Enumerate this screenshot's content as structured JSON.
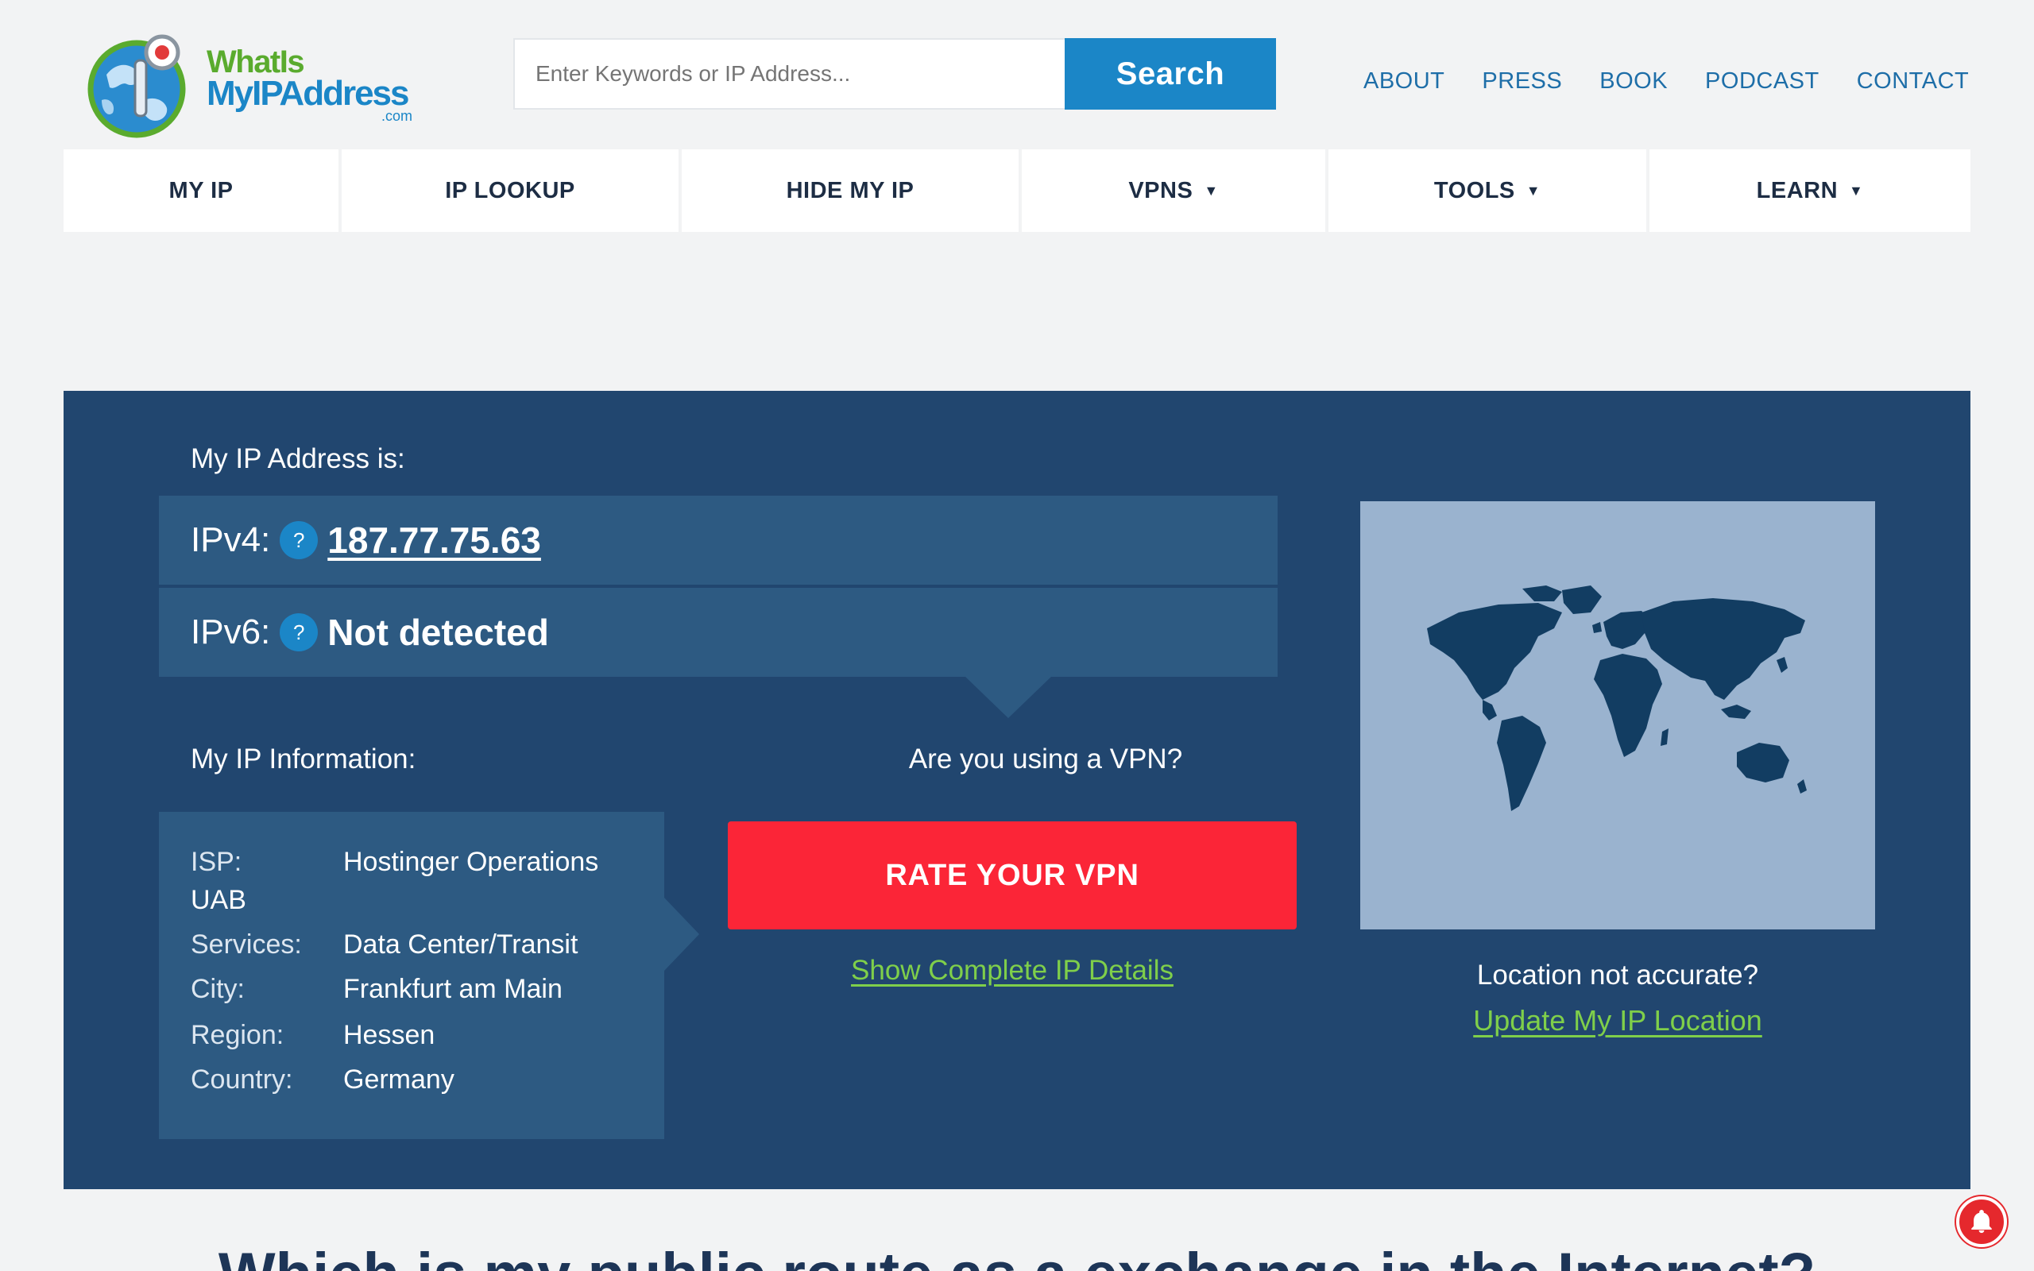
{
  "logo": {
    "line1": "WhatIs",
    "line2": "MyIPAddress",
    "line3": ".com"
  },
  "search": {
    "placeholder": "Enter Keywords or IP Address...",
    "button_label": "Search"
  },
  "top_links": [
    "ABOUT",
    "PRESS",
    "BOOK",
    "PODCAST",
    "CONTACT"
  ],
  "nav": {
    "items": [
      {
        "label": "MY IP",
        "dropdown": false
      },
      {
        "label": "IP LOOKUP",
        "dropdown": false
      },
      {
        "label": "HIDE MY IP",
        "dropdown": false
      },
      {
        "label": "VPNS",
        "dropdown": true
      },
      {
        "label": "TOOLS",
        "dropdown": true
      },
      {
        "label": "LEARN",
        "dropdown": true
      }
    ],
    "caret": "▼"
  },
  "ip": {
    "heading": "My IP Address is:",
    "ipv4_label": "IPv4:",
    "ipv4_value": "187.77.75.63",
    "ipv6_label": "IPv6:",
    "ipv6_value": "Not detected",
    "help_glyph": "?"
  },
  "info": {
    "heading": "My IP Information:",
    "isp_label": "ISP:",
    "isp_value": "Hostinger Operations",
    "isp_value_wrap": "UAB",
    "services_label": "Services:",
    "services_value": "Data Center/Transit",
    "city_label": "City:",
    "city_value": "Frankfurt am Main",
    "region_label": "Region:",
    "region_value": "Hessen",
    "country_label": "Country:",
    "country_value": "Germany"
  },
  "vpn": {
    "question": "Are you using a VPN?",
    "button_label": "RATE YOUR VPN",
    "details_link": "Show Complete IP Details"
  },
  "location": {
    "question": "Location not accurate?",
    "link": "Update My IP Location"
  },
  "bottom_heading": "Which is my public route as a exchange in the Internet?",
  "colors": {
    "brand_blue": "#1b86c7",
    "hero_bg": "#21466f",
    "panel_bg": "#2d5a82",
    "cta_red": "#fb2537",
    "link_green": "#7fcf4a",
    "map_bg": "#9ab3cf"
  },
  "icons": [
    "globe-logo-icon",
    "help-icon",
    "world-map-icon",
    "notification-bell-icon",
    "caret-down-icon"
  ]
}
